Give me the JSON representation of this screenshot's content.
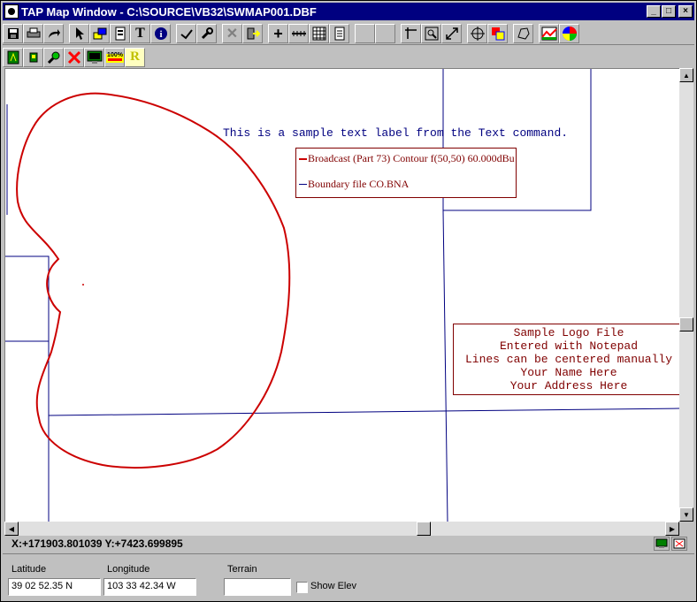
{
  "window": {
    "title": "TAP Map Window - C:\\SOURCE\\VB32\\SWMAP001.DBF",
    "minimize": "_",
    "maximize": "□",
    "close": "×"
  },
  "toolbar1": {
    "tools": [
      "save-icon",
      "print-icon",
      "redo-icon",
      "pointer-icon",
      "layers-icon",
      "properties-icon",
      "text-icon",
      "info-icon",
      "edit-icon",
      "wrench-icon",
      "delete-icon",
      "exit-icon",
      "crosshair-icon",
      "ruler-icon",
      "grid-icon",
      "notepad-icon",
      "blank",
      "blank",
      "axis-icon",
      "zoom-box-icon",
      "expand-icon",
      "pan-icon",
      "overlay-icon",
      "polygon-icon",
      "terrain-icon",
      "color-wheel-icon"
    ],
    "glyphs": {
      "text-icon": "T",
      "info-icon": "i",
      "crosshair-icon": "+",
      "delete-icon": "✕"
    }
  },
  "toolbar2": {
    "tools": [
      "map-green-icon",
      "map-small-icon",
      "magnifier-icon",
      "red-x-icon",
      "monitor-icon",
      "zoom-100-icon",
      "r-icon"
    ],
    "zoom_label": "100%",
    "r_label": "R"
  },
  "map": {
    "sample_text": "This is a sample text label from the Text command.",
    "legend": {
      "items": [
        {
          "label": "Broadcast (Part 73) Contour f(50,50)  60.000dBu",
          "color": "#cc0000"
        },
        {
          "label": "Boundary file CO.BNA",
          "color": "#000080"
        }
      ]
    },
    "logo_lines": [
      "Sample Logo File",
      "Entered with Notepad",
      "Lines can be centered manually",
      "Your Name Here",
      "Your Address Here"
    ],
    "colors": {
      "contour": "#cc0000",
      "boundary": "#000080",
      "logo": "#800000"
    }
  },
  "status": {
    "coords": "X:+171903.801039 Y:+7423.699895"
  },
  "bottom": {
    "latitude_label": "Latitude",
    "latitude_value": "39 02 52.35 N",
    "longitude_label": "Longitude",
    "longitude_value": "103 33 42.34 W",
    "terrain_label": "Terrain",
    "terrain_value": "",
    "show_elev_label": "Show Elev",
    "show_elev_checked": false
  }
}
